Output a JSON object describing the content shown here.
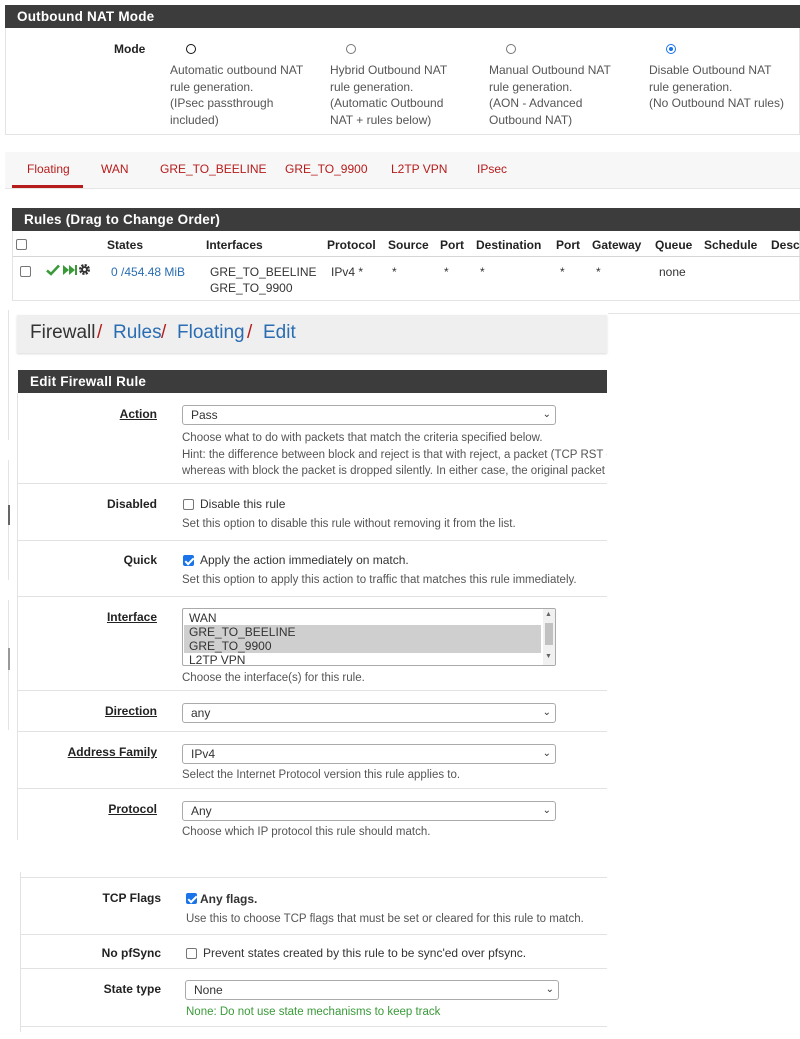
{
  "nat": {
    "title": "Outbound NAT Mode",
    "mode_label": "Mode",
    "options": [
      {
        "lines": [
          "Automatic outbound NAT",
          "rule generation.",
          "(IPsec passthrough",
          "included)"
        ],
        "checked": false
      },
      {
        "lines": [
          "Hybrid Outbound NAT",
          "rule generation.",
          "(Automatic Outbound",
          "NAT + rules below)"
        ],
        "checked": false
      },
      {
        "lines": [
          "Manual Outbound NAT",
          "rule generation.",
          "(AON - Advanced",
          "Outbound NAT)"
        ],
        "checked": false
      },
      {
        "lines": [
          "Disable Outbound NAT",
          "rule generation.",
          "(No Outbound NAT rules)"
        ],
        "checked": true
      }
    ]
  },
  "tabs": [
    "Floating",
    "WAN",
    "GRE_TO_BEELINE",
    "GRE_TO_9900",
    "L2TP VPN",
    "IPsec"
  ],
  "rules": {
    "title": "Rules (Drag to Change Order)",
    "headers": [
      "States",
      "Interfaces",
      "Protocol",
      "Source",
      "Port",
      "Destination",
      "Port",
      "Gateway",
      "Queue",
      "Schedule",
      "Descr"
    ],
    "row": {
      "states": "0 /454.48 MiB",
      "interface_1": "GRE_TO_BEELINE",
      "interface_2": "GRE_TO_9900",
      "protocol": "IPv4 *",
      "source": "*",
      "source_port": "*",
      "destination": "*",
      "destination_port": "*",
      "gateway": "*",
      "queue": "none"
    }
  },
  "breadcrumb": {
    "firewall": "Firewall",
    "rules": "Rules",
    "floating": "Floating",
    "edit": "Edit",
    "sep": "/"
  },
  "form": {
    "title": "Edit Firewall Rule",
    "action": {
      "label": "Action",
      "value": "Pass",
      "help1": "Choose what to do with packets that match the criteria specified below.",
      "help2": "Hint: the difference between block and reject is that with reject, a packet (TCP RST or ICMP port unreachable for UDP) is returned to the sender,",
      "help3": "whereas with block the packet is dropped silently. In either case, the original packet is discarded."
    },
    "disabled": {
      "label": "Disabled",
      "cb_text": "Disable this rule",
      "help": "Set this option to disable this rule without removing it from the list."
    },
    "quick": {
      "label": "Quick",
      "cb_text": "Apply the action immediately on match.",
      "help": "Set this option to apply this action to traffic that matches this rule immediately."
    },
    "interface": {
      "label": "Interface",
      "options": [
        "WAN",
        "GRE_TO_BEELINE",
        "GRE_TO_9900",
        "L2TP VPN"
      ],
      "help": "Choose the interface(s) for this rule."
    },
    "direction": {
      "label": "Direction",
      "value": "any"
    },
    "address_family": {
      "label": "Address Family",
      "value": "IPv4",
      "help": "Select the Internet Protocol version this rule applies to."
    },
    "protocol": {
      "label": "Protocol",
      "value": "Any",
      "help": "Choose which IP protocol this rule should match."
    },
    "tcp_flags": {
      "label": "TCP Flags",
      "cb_text": "Any flags.",
      "help": "Use this to choose TCP flags that must be set or cleared for this rule to match."
    },
    "no_pfsync": {
      "label": "No pfSync",
      "cb_text": "Prevent states created by this rule to be sync'ed over pfsync."
    },
    "state_type": {
      "label": "State type",
      "value": "None",
      "help": "None: Do not use state mechanisms to keep track"
    }
  },
  "colors": {
    "heading_bg": "#3c3c3c",
    "tab_red": "#b71c1c",
    "link_blue": "#2a6db2",
    "check_green": "#3a9a3a",
    "help_green": "#3a9a3a"
  }
}
